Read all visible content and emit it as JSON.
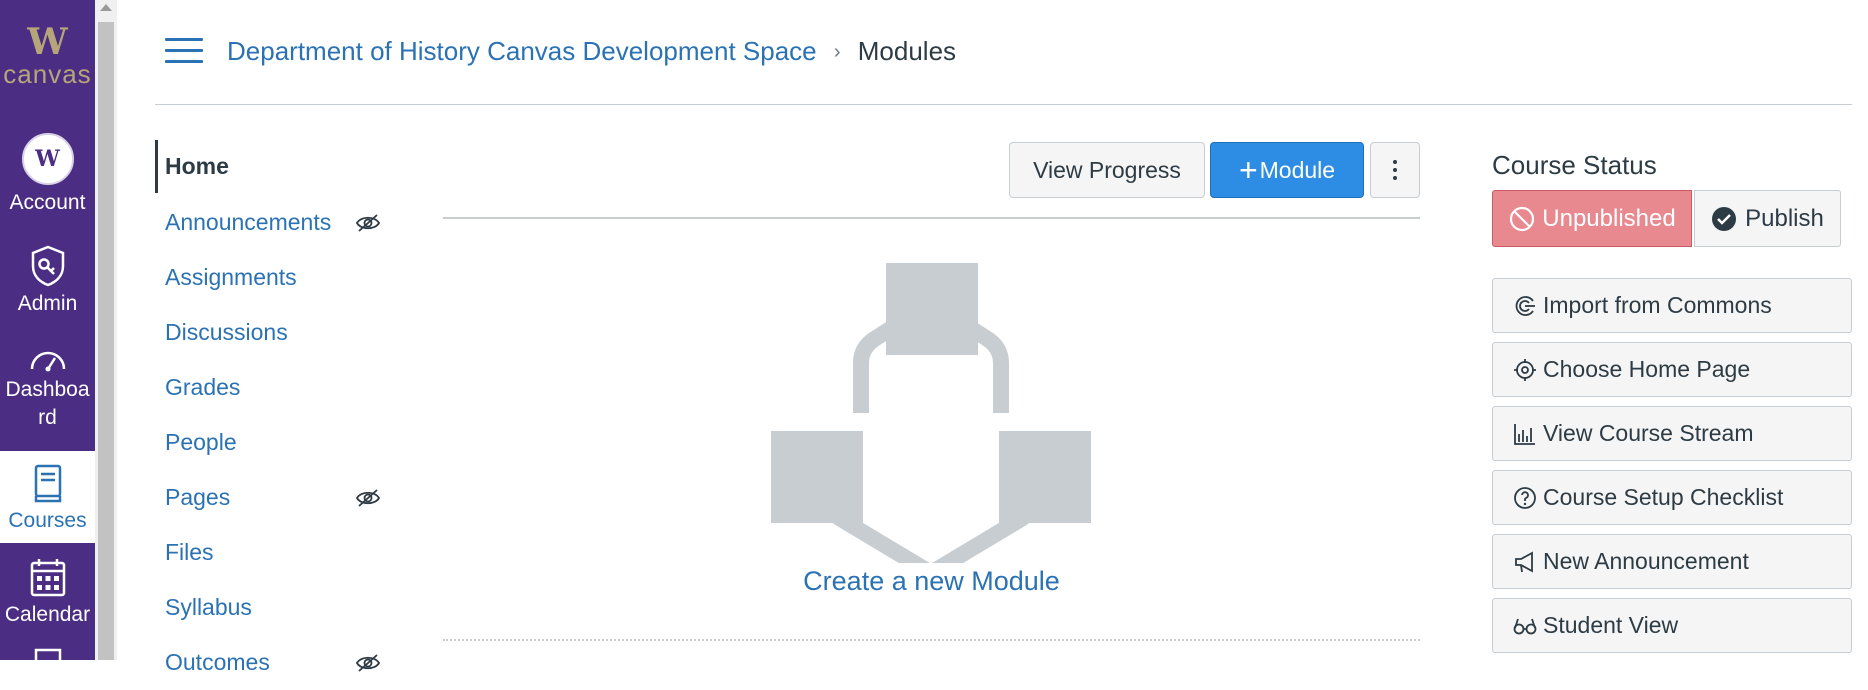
{
  "global_nav": {
    "logo_letter": "W",
    "logo_text": "canvas",
    "account_avatar": "W",
    "items": [
      {
        "label": "Account",
        "icon": "account-avatar"
      },
      {
        "label": "Admin",
        "icon": "admin-shield-icon"
      },
      {
        "label": "Dashboa rd",
        "icon": "dashboard-gauge-icon"
      },
      {
        "label": "Courses",
        "icon": "courses-book-icon",
        "active": true
      },
      {
        "label": "Calendar",
        "icon": "calendar-icon"
      }
    ]
  },
  "breadcrumb": {
    "course": "Department of History Canvas Development Space",
    "separator": "›",
    "current": "Modules"
  },
  "course_nav": {
    "items": [
      {
        "label": "Home",
        "active": true
      },
      {
        "label": "Announcements",
        "hidden": true
      },
      {
        "label": "Assignments"
      },
      {
        "label": "Discussions"
      },
      {
        "label": "Grades"
      },
      {
        "label": "People"
      },
      {
        "label": "Pages",
        "hidden": true
      },
      {
        "label": "Files"
      },
      {
        "label": "Syllabus"
      },
      {
        "label": "Outcomes",
        "hidden": true
      }
    ]
  },
  "toolbar": {
    "view_progress": "View Progress",
    "add_module": "Module",
    "add_module_prefix": "+"
  },
  "empty_state": {
    "create_link": "Create a new Module"
  },
  "course_status": {
    "heading": "Course Status",
    "unpublished": "Unpublished",
    "publish": "Publish"
  },
  "sidebar_actions": [
    {
      "label": "Import from Commons",
      "icon": "commons-icon"
    },
    {
      "label": "Choose Home Page",
      "icon": "target-icon"
    },
    {
      "label": "View Course Stream",
      "icon": "stream-chart-icon"
    },
    {
      "label": "Course Setup Checklist",
      "icon": "question-circle-icon"
    },
    {
      "label": "New Announcement",
      "icon": "megaphone-icon"
    },
    {
      "label": "Student View",
      "icon": "glasses-icon"
    }
  ],
  "colors": {
    "global_nav_bg": "#4b2e83",
    "logo_gold": "#b7a57a",
    "link_blue": "#2b72b4",
    "primary_button": "#2d8ce3",
    "unpublished_bg": "#e8888f",
    "placeholder_gray": "#c7cdd1"
  }
}
